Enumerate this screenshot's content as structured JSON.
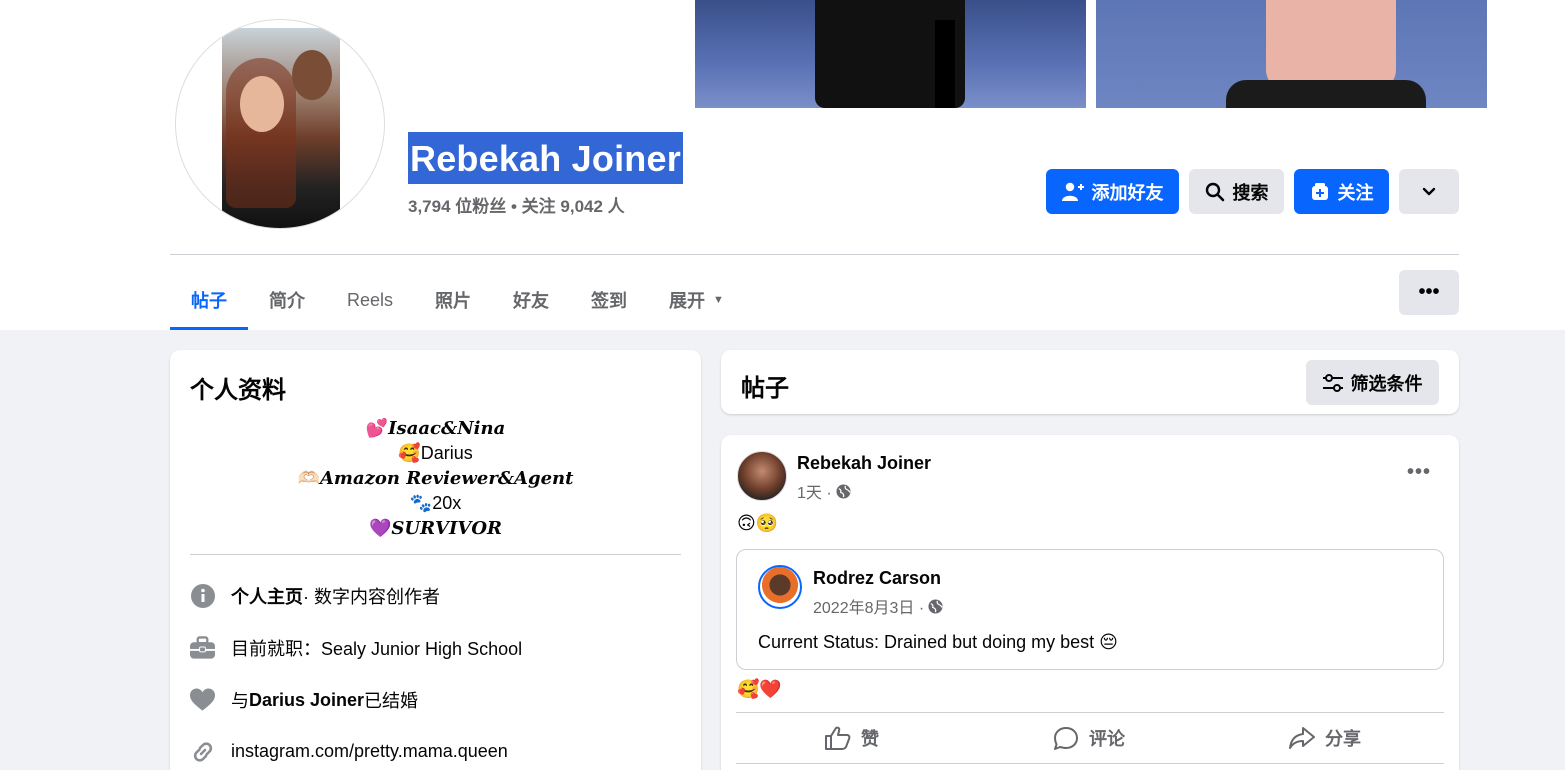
{
  "profile": {
    "name": "Rebekah Joiner",
    "stats": "3,794 位粉丝 • 关注 9,042 人"
  },
  "actions": {
    "add_friend": "添加好友",
    "search": "搜索",
    "follow": "关注"
  },
  "tabs": [
    {
      "label": "帖子"
    },
    {
      "label": "简介"
    },
    {
      "label": "Reels"
    },
    {
      "label": "照片"
    },
    {
      "label": "好友"
    },
    {
      "label": "签到"
    },
    {
      "label": "展开"
    }
  ],
  "intro": {
    "title": "个人资料",
    "bio": [
      {
        "emoji": "💕",
        "text": "𝑰𝒔𝒂𝒂𝒄&𝑵𝒊𝒏𝒂"
      },
      {
        "emoji": "🥰",
        "text": "Darius"
      },
      {
        "emoji": "🫶🏻",
        "text": "𝑨𝒎𝒂𝒛𝒐𝒏 𝑹𝒆𝒗𝒊𝒆𝒘𝒆𝒓&𝑨𝒈𝒆𝒏𝒕"
      },
      {
        "emoji": "🐾",
        "text": "20x"
      },
      {
        "emoji": "💜",
        "text": "𝑺𝑼𝑹𝑽𝑰𝑽𝑶𝑹"
      }
    ],
    "items": [
      {
        "icon": "info-icon",
        "bold": "个人主页",
        "text": " · 数字内容创作者"
      },
      {
        "icon": "briefcase-icon",
        "bold": "",
        "text": "目前就职：Sealy Junior High School"
      },
      {
        "icon": "heart-icon",
        "pre": "与 ",
        "bold": "Darius Joiner",
        "text": " 已结婚"
      },
      {
        "icon": "link-icon",
        "bold": "",
        "text": "instagram.com/pretty.mama.queen"
      }
    ]
  },
  "posts_header": {
    "title": "帖子",
    "filter": "筛选条件"
  },
  "post": {
    "author": "Rebekah Joiner",
    "time": "1天 ·",
    "emoji": "🙃🥺",
    "shared": {
      "author": "Rodrez Carson",
      "time": "2022年8月3日 ·",
      "text": "Current Status: Drained but doing my best 😔"
    },
    "reactions": "🥰❤️",
    "like": "赞",
    "comment": "评论",
    "share": "分享"
  },
  "colors": {
    "accent": "#0866ff",
    "selection": "#3367d6",
    "muted": "#65676b",
    "bg": "#f0f2f5"
  }
}
